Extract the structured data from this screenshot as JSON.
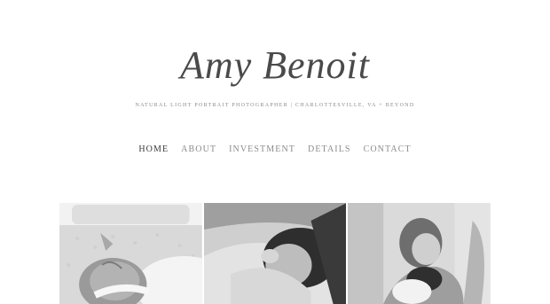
{
  "site": {
    "logo_text": "Amy Benoit",
    "tagline": "NATURAL LIGHT PORTRAIT PHOTOGRAPHER | CHARLOTTESVILLE, VA + BEYOND"
  },
  "nav": {
    "items": [
      {
        "label": "HOME",
        "active": true
      },
      {
        "label": "ABOUT",
        "active": false
      },
      {
        "label": "INVESTMENT",
        "active": false
      },
      {
        "label": "DETAILS",
        "active": false
      },
      {
        "label": "CONTACT",
        "active": false
      }
    ]
  },
  "gallery": {
    "photos": [
      {
        "subject": "newborn-sleeping-on-blanket"
      },
      {
        "subject": "newborn-swaddled-in-arms"
      },
      {
        "subject": "mother-holding-newborn"
      }
    ]
  }
}
